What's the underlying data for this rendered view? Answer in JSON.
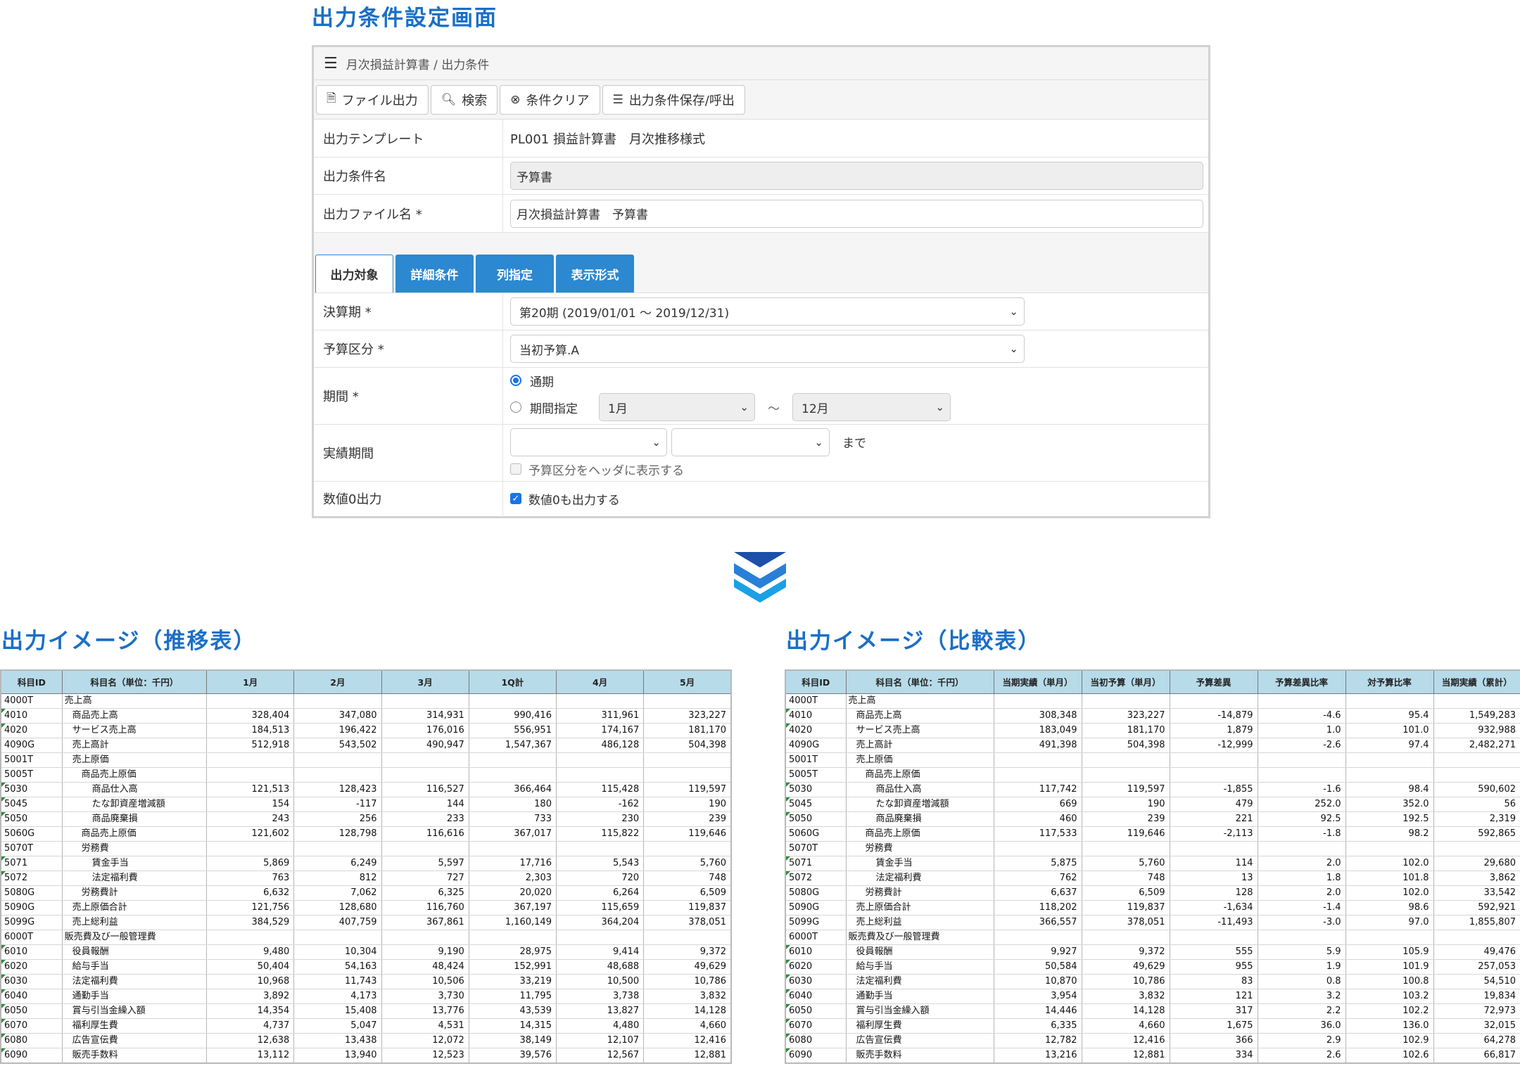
{
  "titles": {
    "form": "出力条件設定画面",
    "trend": "出力イメージ（推移表）",
    "compare": "出力イメージ（比較表）"
  },
  "form": {
    "breadcrumb": "月次損益計算書 / 出力条件",
    "toolbar": {
      "file_output": "ファイル出力",
      "search": "検索",
      "clear": "条件クリア",
      "save_load": "出力条件保存/呼出"
    },
    "template_label": "出力テンプレート",
    "template_value": "PL001 損益計算書　月次推移様式",
    "condition_name_label": "出力条件名",
    "condition_name_value": "予算書",
    "file_name_label": "出力ファイル名 *",
    "file_name_value": "月次損益計算書　予算書",
    "tabs": [
      "出力対象",
      "詳細条件",
      "列指定",
      "表示形式"
    ],
    "fiscal_label": "決算期 *",
    "fiscal_value": "第20期 (2019/01/01 ～ 2019/12/31)",
    "budget_label": "予算区分 *",
    "budget_value": "当初予算.A",
    "period_label": "期間 *",
    "period_full": "通期",
    "period_specify": "期間指定",
    "period_from": "1月",
    "period_tilde": "～",
    "period_to": "12月",
    "actual_label": "実績期間",
    "actual_until": "まで",
    "actual_header_check": "予算区分をヘッダに表示する",
    "zero_label": "数値0出力",
    "zero_check": "数値0も出力する"
  },
  "trend_table": {
    "headers": [
      "科目ID",
      "科目名（単位：千円）",
      "1月",
      "2月",
      "3月",
      "1Q計",
      "4月",
      "5月"
    ],
    "rows": [
      [
        "4000T",
        "売上高",
        "",
        "",
        "",
        "",
        "",
        ""
      ],
      [
        "4010",
        "商品売上高",
        "328,404",
        "347,080",
        "314,931",
        "990,416",
        "311,961",
        "323,227"
      ],
      [
        "4020",
        "サービス売上高",
        "184,513",
        "196,422",
        "176,016",
        "556,951",
        "174,167",
        "181,170"
      ],
      [
        "4090G",
        "売上高計",
        "512,918",
        "543,502",
        "490,947",
        "1,547,367",
        "486,128",
        "504,398"
      ],
      [
        "5001T",
        "売上原価",
        "",
        "",
        "",
        "",
        "",
        ""
      ],
      [
        "5005T",
        "商品売上原価",
        "",
        "",
        "",
        "",
        "",
        ""
      ],
      [
        "5030",
        "商品仕入高",
        "121,513",
        "128,423",
        "116,527",
        "366,464",
        "115,428",
        "119,597"
      ],
      [
        "5045",
        "たな卸資産増減額",
        "154",
        "-117",
        "144",
        "180",
        "-162",
        "190"
      ],
      [
        "5050",
        "商品廃棄損",
        "243",
        "256",
        "233",
        "733",
        "230",
        "239"
      ],
      [
        "5060G",
        "商品売上原価",
        "121,602",
        "128,798",
        "116,616",
        "367,017",
        "115,822",
        "119,646"
      ],
      [
        "5070T",
        "労務費",
        "",
        "",
        "",
        "",
        "",
        ""
      ],
      [
        "5071",
        "賃金手当",
        "5,869",
        "6,249",
        "5,597",
        "17,716",
        "5,543",
        "5,760"
      ],
      [
        "5072",
        "法定福利費",
        "763",
        "812",
        "727",
        "2,303",
        "720",
        "748"
      ],
      [
        "5080G",
        "労務費計",
        "6,632",
        "7,062",
        "6,325",
        "20,020",
        "6,264",
        "6,509"
      ],
      [
        "5090G",
        "売上原価合計",
        "121,756",
        "128,680",
        "116,760",
        "367,197",
        "115,659",
        "119,837"
      ],
      [
        "5099G",
        "売上総利益",
        "384,529",
        "407,759",
        "367,861",
        "1,160,149",
        "364,204",
        "378,051"
      ],
      [
        "6000T",
        "販売費及び一般管理費",
        "",
        "",
        "",
        "",
        "",
        ""
      ],
      [
        "6010",
        "役員報酬",
        "9,480",
        "10,304",
        "9,190",
        "28,975",
        "9,414",
        "9,372"
      ],
      [
        "6020",
        "給与手当",
        "50,404",
        "54,163",
        "48,424",
        "152,991",
        "48,688",
        "49,629"
      ],
      [
        "6030",
        "法定福利費",
        "10,968",
        "11,743",
        "10,506",
        "33,219",
        "10,500",
        "10,786"
      ],
      [
        "6040",
        "通勤手当",
        "3,892",
        "4,173",
        "3,730",
        "11,795",
        "3,738",
        "3,832"
      ],
      [
        "6050",
        "賞与引当金繰入額",
        "14,354",
        "15,408",
        "13,776",
        "43,539",
        "13,827",
        "14,128"
      ],
      [
        "6070",
        "福利厚生費",
        "4,737",
        "5,047",
        "4,531",
        "14,315",
        "4,480",
        "4,660"
      ],
      [
        "6080",
        "広告宣伝費",
        "12,638",
        "13,438",
        "12,072",
        "38,149",
        "12,107",
        "12,416"
      ],
      [
        "6090",
        "販売手数料",
        "13,112",
        "13,940",
        "12,523",
        "39,576",
        "12,567",
        "12,881"
      ]
    ]
  },
  "compare_table": {
    "headers": [
      "科目ID",
      "科目名（単位：千円）",
      "当期実績（単月）",
      "当初予算（単月）",
      "予算差異",
      "予算差異比率",
      "対予算比率",
      "当期実績（累計）"
    ],
    "rows": [
      [
        "4000T",
        "売上高",
        "",
        "",
        "",
        "",
        "",
        ""
      ],
      [
        "4010",
        "商品売上高",
        "308,348",
        "323,227",
        "-14,879",
        "-4.6",
        "95.4",
        "1,549,283"
      ],
      [
        "4020",
        "サービス売上高",
        "183,049",
        "181,170",
        "1,879",
        "1.0",
        "101.0",
        "932,988"
      ],
      [
        "4090G",
        "売上高計",
        "491,398",
        "504,398",
        "-12,999",
        "-2.6",
        "97.4",
        "2,482,271"
      ],
      [
        "5001T",
        "売上原価",
        "",
        "",
        "",
        "",
        "",
        ""
      ],
      [
        "5005T",
        "商品売上原価",
        "",
        "",
        "",
        "",
        "",
        ""
      ],
      [
        "5030",
        "商品仕入高",
        "117,742",
        "119,597",
        "-1,855",
        "-1.6",
        "98.4",
        "590,602"
      ],
      [
        "5045",
        "たな卸資産増減額",
        "669",
        "190",
        "479",
        "252.0",
        "352.0",
        "56"
      ],
      [
        "5050",
        "商品廃棄損",
        "460",
        "239",
        "221",
        "92.5",
        "192.5",
        "2,319"
      ],
      [
        "5060G",
        "商品売上原価",
        "117,533",
        "119,646",
        "-2,113",
        "-1.8",
        "98.2",
        "592,865"
      ],
      [
        "5070T",
        "労務費",
        "",
        "",
        "",
        "",
        "",
        ""
      ],
      [
        "5071",
        "賃金手当",
        "5,875",
        "5,760",
        "114",
        "2.0",
        "102.0",
        "29,680"
      ],
      [
        "5072",
        "法定福利費",
        "762",
        "748",
        "13",
        "1.8",
        "101.8",
        "3,862"
      ],
      [
        "5080G",
        "労務費計",
        "6,637",
        "6,509",
        "128",
        "2.0",
        "102.0",
        "33,542"
      ],
      [
        "5090G",
        "売上原価合計",
        "118,202",
        "119,837",
        "-1,634",
        "-1.4",
        "98.6",
        "592,921"
      ],
      [
        "5099G",
        "売上総利益",
        "366,557",
        "378,051",
        "-11,493",
        "-3.0",
        "97.0",
        "1,855,807"
      ],
      [
        "6000T",
        "販売費及び一般管理費",
        "",
        "",
        "",
        "",
        "",
        ""
      ],
      [
        "6010",
        "役員報酬",
        "9,927",
        "9,372",
        "555",
        "5.9",
        "105.9",
        "49,476"
      ],
      [
        "6020",
        "給与手当",
        "50,584",
        "49,629",
        "955",
        "1.9",
        "101.9",
        "257,053"
      ],
      [
        "6030",
        "法定福利費",
        "10,870",
        "10,786",
        "83",
        "0.8",
        "100.8",
        "54,510"
      ],
      [
        "6040",
        "通勤手当",
        "3,954",
        "3,832",
        "121",
        "3.2",
        "103.2",
        "19,834"
      ],
      [
        "6050",
        "賞与引当金繰入額",
        "14,446",
        "14,128",
        "317",
        "2.2",
        "102.2",
        "72,973"
      ],
      [
        "6070",
        "福利厚生費",
        "6,335",
        "4,660",
        "1,675",
        "36.0",
        "136.0",
        "32,015"
      ],
      [
        "6080",
        "広告宣伝費",
        "12,782",
        "12,416",
        "366",
        "2.9",
        "102.9",
        "64,278"
      ],
      [
        "6090",
        "販売手数料",
        "13,216",
        "12,881",
        "334",
        "2.6",
        "102.6",
        "66,817"
      ]
    ]
  }
}
